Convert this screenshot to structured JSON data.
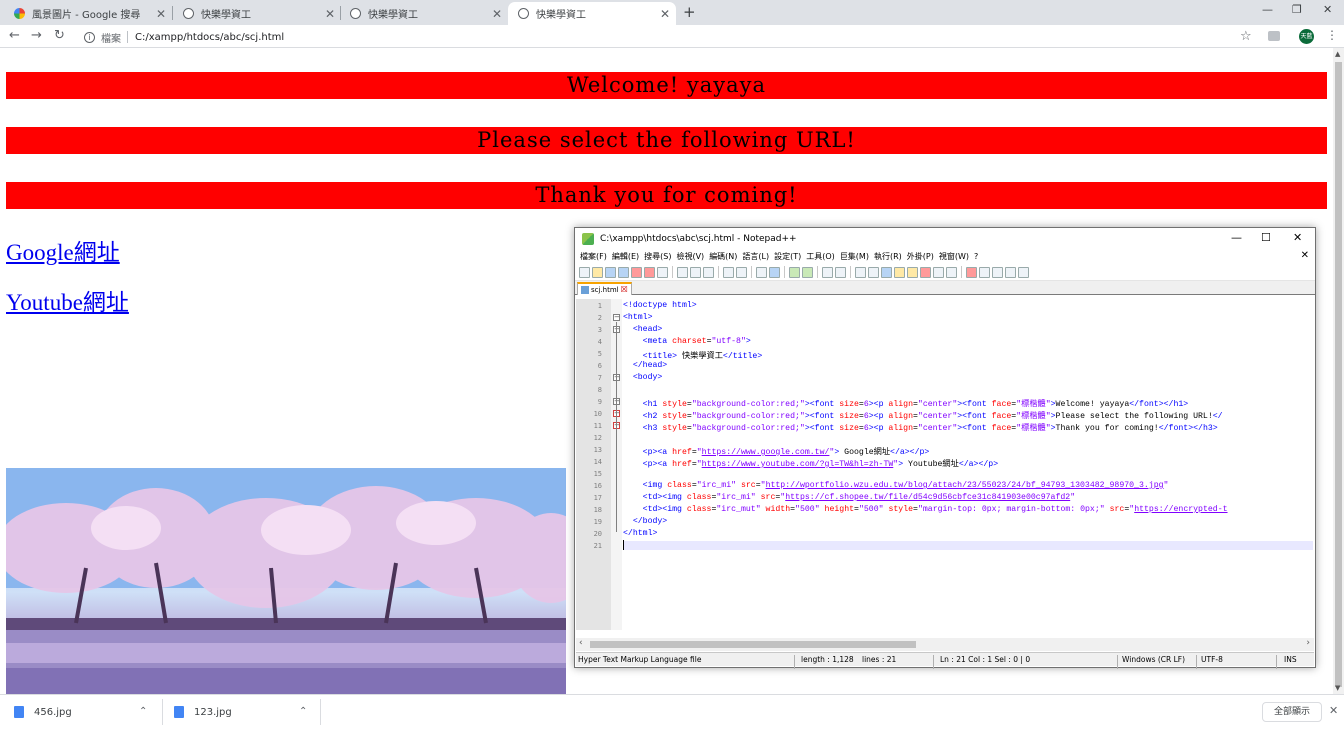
{
  "browser": {
    "tabs": [
      {
        "title": "風景圖片 - Google 搜尋",
        "favicon": "google-icon"
      },
      {
        "title": "快樂學資工",
        "favicon": "globe-icon"
      },
      {
        "title": "快樂學資工",
        "favicon": "globe-icon"
      },
      {
        "title": "快樂學資工",
        "favicon": "globe-icon",
        "active": true
      }
    ],
    "omnibox": {
      "label": "檔案",
      "url": "C:/xampp/htdocs/abc/scj.html"
    },
    "avatar_text": "天藍"
  },
  "page": {
    "h1": "Welcome! yayaya",
    "h2": "Please select the following URL!",
    "h3": "Thank you for coming!",
    "links": [
      "Google網址",
      "Youtube網址"
    ],
    "banner_color": "#ff0000",
    "link_color": "#0000ee"
  },
  "notepad": {
    "title": "C:\\xampp\\htdocs\\abc\\scj.html - Notepad++",
    "menu": [
      "檔案(F)",
      "編輯(E)",
      "搜尋(S)",
      "檢視(V)",
      "編碼(N)",
      "語言(L)",
      "設定(T)",
      "工具(O)",
      "巨集(M)",
      "執行(R)",
      "外掛(P)",
      "視窗(W)",
      "?"
    ],
    "tab": "scj.html",
    "status": {
      "filetype": "Hyper Text Markup Language file",
      "length": "length : 1,128",
      "lines": "lines : 21",
      "position": "Ln : 21    Col : 1    Sel : 0 | 0",
      "eol": "Windows (CR LF)",
      "encoding": "UTF-8",
      "mode": "INS"
    },
    "line_numbers": [
      "1",
      "2",
      "3",
      "4",
      "5",
      "6",
      "7",
      "8",
      "9",
      "10",
      "11",
      "12",
      "13",
      "14",
      "15",
      "16",
      "17",
      "18",
      "19",
      "20",
      "21"
    ]
  },
  "downloads": {
    "items": [
      "456.jpg",
      "123.jpg"
    ],
    "show_all": "全部顯示"
  }
}
